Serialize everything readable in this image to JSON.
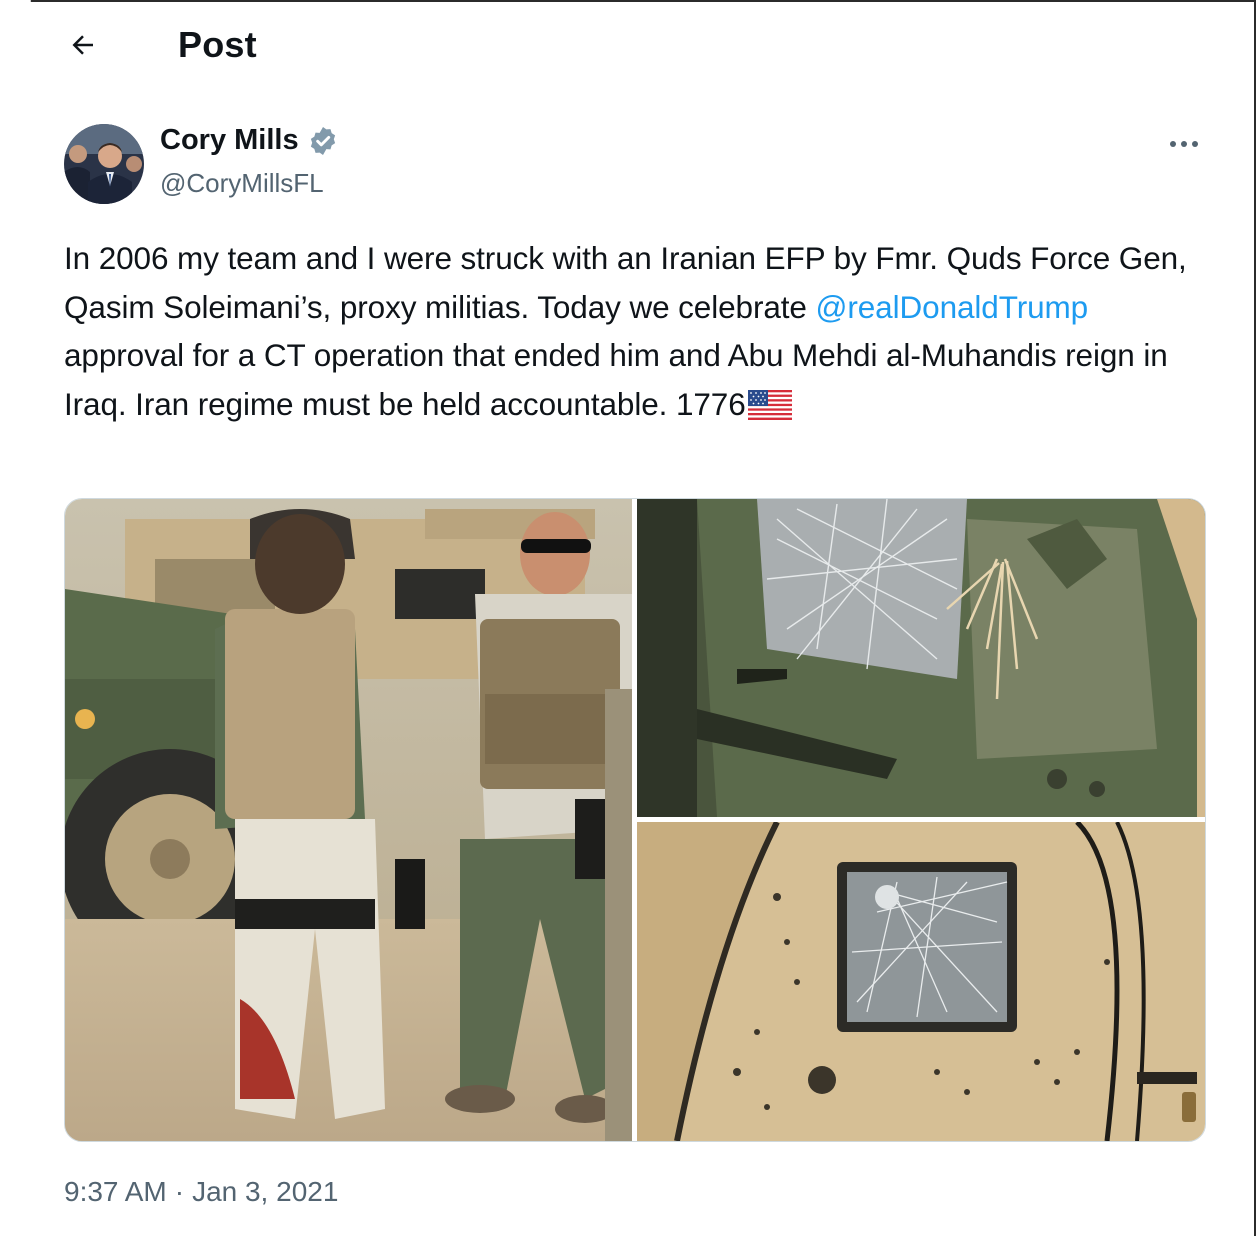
{
  "header": {
    "back_icon": "arrow-left-icon",
    "title": "Post"
  },
  "author": {
    "name": "Cory Mills",
    "handle": "@CoryMillsFL",
    "verified_icon": "verified-badge-icon",
    "more_icon": "more-options-icon"
  },
  "tweet": {
    "text_part1": "In 2006 my team and I were struck with an Iranian EFP by Fmr. Quds Force Gen, Qasim Soleimani’s, proxy militias. Today we celebrate ",
    "mention": "@realDonaldTrump",
    "text_part2": " approval for a CT operation that ended him and Abu Mehdi al-Muhandis reign in Iraq. Iran regime must be held accountable. 1776",
    "flag_icon": "us-flag-icon"
  },
  "media": {
    "count": 3
  },
  "meta": {
    "time": "9:37 AM",
    "separator": "·",
    "date": "Jan 3, 2021"
  },
  "colors": {
    "accent": "#1d9bf0",
    "secondary_text": "#536471",
    "border": "#cfd9de"
  }
}
